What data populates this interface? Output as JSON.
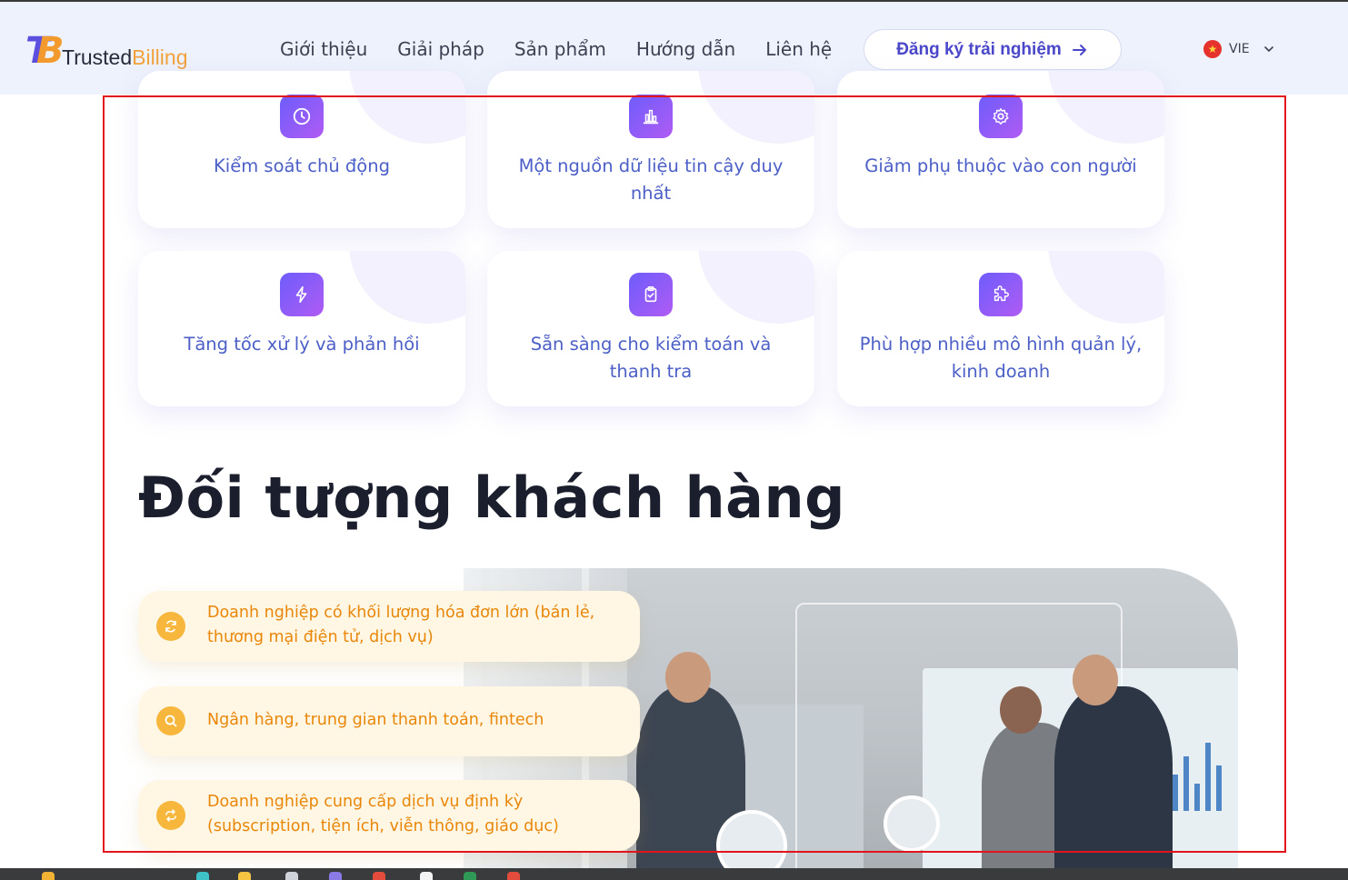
{
  "header": {
    "logo": {
      "text_main": "Trusted",
      "text_accent": "Billing",
      "mark": "TB"
    },
    "nav": [
      {
        "label": "Giới thiệu"
      },
      {
        "label": "Giải pháp"
      },
      {
        "label": "Sản phẩm"
      },
      {
        "label": "Hướng dẫn"
      },
      {
        "label": "Liên hệ"
      }
    ],
    "cta_label": "Đăng ký trải nghiệm",
    "language": {
      "label": "VIE",
      "flag": "vietnam-flag-icon"
    }
  },
  "benefits": [
    {
      "label": "Kiểm soát chủ động",
      "icon": "clock-icon"
    },
    {
      "label": "Một nguồn dữ liệu tin cậy duy nhất",
      "icon": "bar-chart-icon"
    },
    {
      "label": "Giảm phụ thuộc vào con người",
      "icon": "gear-icon"
    },
    {
      "label": "Tăng tốc xử lý và phản hồi",
      "icon": "lightning-icon"
    },
    {
      "label": "Sẵn sàng cho kiểm toán và thanh tra",
      "icon": "clipboard-check-icon"
    },
    {
      "label": "Phù hợp nhiều mô hình quản lý, kinh doanh",
      "icon": "puzzle-icon"
    }
  ],
  "customers": {
    "title": "Đối tượng khách hàng",
    "items": [
      {
        "label": "Doanh nghiệp có khối lượng hóa đơn lớn (bán lẻ, thương mại điện tử, dịch vụ)",
        "icon": "refresh-icon"
      },
      {
        "label": "Ngân hàng, trung gian thanh toán, fintech",
        "icon": "search-icon"
      },
      {
        "label": "Doanh nghiệp cung cấp dịch vụ định kỳ (subscription, tiện ích, viễn thông, giáo dục)",
        "icon": "repeat-icon"
      }
    ]
  },
  "colors": {
    "brand_primary": "#4b47c9",
    "brand_accent": "#f2a23c",
    "card_text": "#4c5fc7",
    "pill_text": "#e8870a",
    "selection_outline": "#e2141c"
  }
}
